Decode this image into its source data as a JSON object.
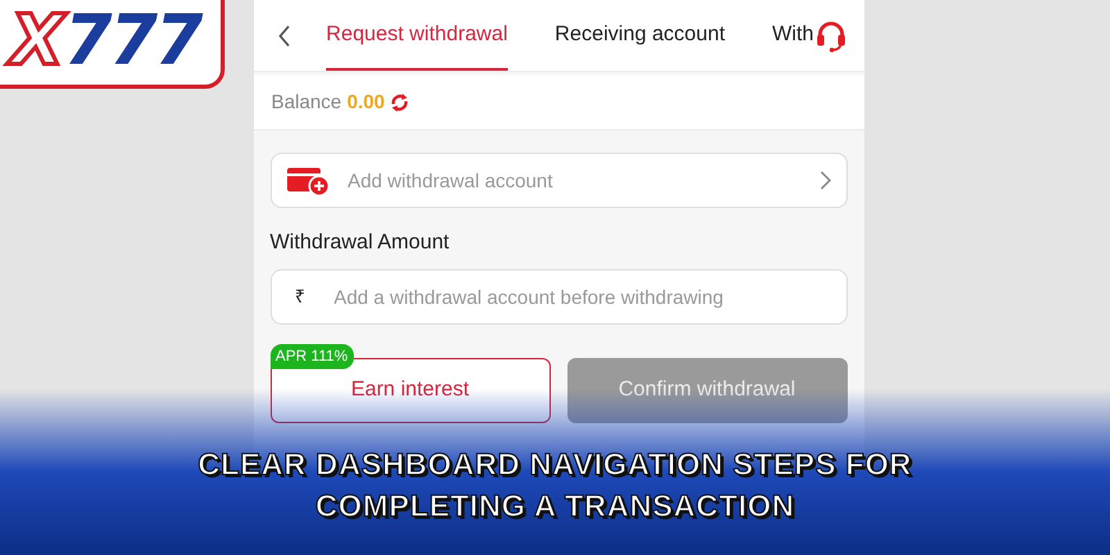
{
  "logo": {
    "prefix": "X",
    "number": "777"
  },
  "header": {
    "tabs": [
      {
        "label": "Request withdrawal",
        "selected": true
      },
      {
        "label": "Receiving account",
        "selected": false
      },
      {
        "label": "With",
        "selected": false
      }
    ]
  },
  "balance": {
    "label": "Balance",
    "value": "0.00"
  },
  "account_row": {
    "placeholder": "Add withdrawal account"
  },
  "amount": {
    "label": "Withdrawal Amount",
    "currency": "₹",
    "placeholder": "Add a withdrawal account before withdrawing"
  },
  "buttons": [
    {
      "label": "Earn interest",
      "kind": "outline",
      "badge": "APR 111%"
    },
    {
      "label": "Confirm withdrawal",
      "kind": "solid",
      "disabled": true
    }
  ],
  "caption": [
    "CLEAR DASHBOARD NAVIGATION STEPS FOR",
    "COMPLETING A TRANSACTION"
  ]
}
